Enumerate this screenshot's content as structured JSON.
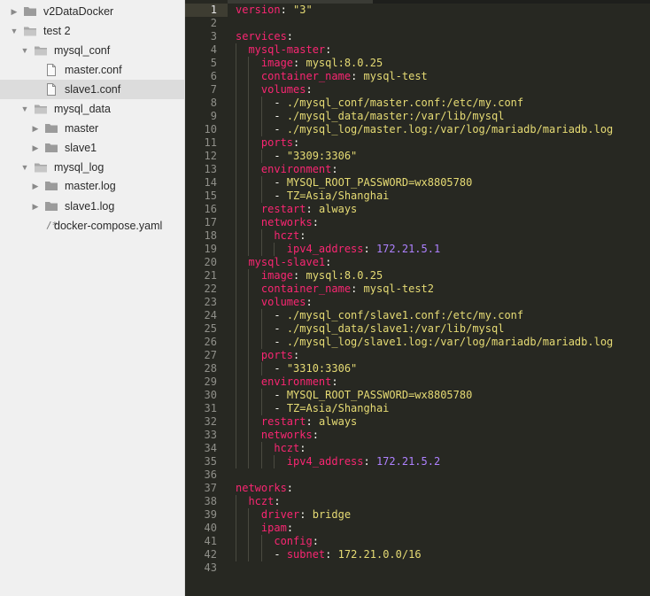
{
  "sidebar": {
    "items": [
      {
        "label": "v2DataDocker",
        "type": "folder",
        "depth": 0,
        "expanded": false
      },
      {
        "label": "test 2",
        "type": "folder-open",
        "depth": 0,
        "expanded": true
      },
      {
        "label": "mysql_conf",
        "type": "folder-open",
        "depth": 1,
        "expanded": true
      },
      {
        "label": "master.conf",
        "type": "file",
        "depth": 2
      },
      {
        "label": "slave1.conf",
        "type": "file",
        "depth": 2,
        "selected": true
      },
      {
        "label": "mysql_data",
        "type": "folder-open",
        "depth": 1,
        "expanded": true
      },
      {
        "label": "master",
        "type": "folder",
        "depth": 2,
        "expanded": false
      },
      {
        "label": "slave1",
        "type": "folder",
        "depth": 2,
        "expanded": false
      },
      {
        "label": "mysql_log",
        "type": "folder-open",
        "depth": 1,
        "expanded": true
      },
      {
        "label": "master.log",
        "type": "folder",
        "depth": 2,
        "expanded": false
      },
      {
        "label": "slave1.log",
        "type": "folder",
        "depth": 2,
        "expanded": false
      },
      {
        "label": "docker-compose.yaml",
        "type": "code-file",
        "depth": 1,
        "glyph": "/*"
      }
    ]
  },
  "editor": {
    "active_line": 1,
    "lines": [
      {
        "n": "1",
        "indent": 0,
        "t": [
          [
            "k",
            "version"
          ],
          [
            "p",
            ": "
          ],
          [
            "s",
            "\"3\""
          ]
        ]
      },
      {
        "n": "2",
        "indent": 0,
        "t": []
      },
      {
        "n": "3",
        "indent": 0,
        "t": [
          [
            "k",
            "services"
          ],
          [
            "p",
            ":"
          ]
        ]
      },
      {
        "n": "4",
        "indent": 1,
        "t": [
          [
            "k",
            "mysql-master"
          ],
          [
            "p",
            ":"
          ]
        ]
      },
      {
        "n": "5",
        "indent": 2,
        "t": [
          [
            "k",
            "image"
          ],
          [
            "p",
            ": "
          ],
          [
            "s",
            "mysql:8.0.25"
          ]
        ]
      },
      {
        "n": "6",
        "indent": 2,
        "t": [
          [
            "k",
            "container_name"
          ],
          [
            "p",
            ": "
          ],
          [
            "s",
            "mysql-test"
          ]
        ]
      },
      {
        "n": "7",
        "indent": 2,
        "t": [
          [
            "k",
            "volumes"
          ],
          [
            "p",
            ":"
          ]
        ]
      },
      {
        "n": "8",
        "indent": 3,
        "t": [
          [
            "p",
            "- "
          ],
          [
            "s",
            "./mysql_conf/master.conf:/etc/my.conf"
          ]
        ]
      },
      {
        "n": "9",
        "indent": 3,
        "t": [
          [
            "p",
            "- "
          ],
          [
            "s",
            "./mysql_data/master:/var/lib/mysql"
          ]
        ]
      },
      {
        "n": "10",
        "indent": 3,
        "t": [
          [
            "p",
            "- "
          ],
          [
            "s",
            "./mysql_log/master.log:/var/log/mariadb/mariadb.log"
          ]
        ]
      },
      {
        "n": "11",
        "indent": 2,
        "t": [
          [
            "k",
            "ports"
          ],
          [
            "p",
            ":"
          ]
        ]
      },
      {
        "n": "12",
        "indent": 3,
        "t": [
          [
            "p",
            "- "
          ],
          [
            "s",
            "\"3309:3306\""
          ]
        ]
      },
      {
        "n": "13",
        "indent": 2,
        "t": [
          [
            "k",
            "environment"
          ],
          [
            "p",
            ":"
          ]
        ]
      },
      {
        "n": "14",
        "indent": 3,
        "t": [
          [
            "p",
            "- "
          ],
          [
            "s",
            "MYSQL_ROOT_PASSWORD=wx8805780"
          ]
        ]
      },
      {
        "n": "15",
        "indent": 3,
        "t": [
          [
            "p",
            "- "
          ],
          [
            "s",
            "TZ=Asia/Shanghai"
          ]
        ]
      },
      {
        "n": "16",
        "indent": 2,
        "t": [
          [
            "k",
            "restart"
          ],
          [
            "p",
            ": "
          ],
          [
            "s",
            "always"
          ]
        ]
      },
      {
        "n": "17",
        "indent": 2,
        "t": [
          [
            "k",
            "networks"
          ],
          [
            "p",
            ":"
          ]
        ]
      },
      {
        "n": "18",
        "indent": 3,
        "t": [
          [
            "k",
            "hczt"
          ],
          [
            "p",
            ":"
          ]
        ]
      },
      {
        "n": "19",
        "indent": 4,
        "t": [
          [
            "k",
            "ipv4_address"
          ],
          [
            "p",
            ": "
          ],
          [
            "n",
            "172.21.5.1"
          ]
        ]
      },
      {
        "n": "20",
        "indent": 1,
        "t": [
          [
            "k",
            "mysql-slave1"
          ],
          [
            "p",
            ":"
          ]
        ]
      },
      {
        "n": "21",
        "indent": 2,
        "t": [
          [
            "k",
            "image"
          ],
          [
            "p",
            ": "
          ],
          [
            "s",
            "mysql:8.0.25"
          ]
        ]
      },
      {
        "n": "22",
        "indent": 2,
        "t": [
          [
            "k",
            "container_name"
          ],
          [
            "p",
            ": "
          ],
          [
            "s",
            "mysql-test2"
          ]
        ]
      },
      {
        "n": "23",
        "indent": 2,
        "t": [
          [
            "k",
            "volumes"
          ],
          [
            "p",
            ":"
          ]
        ]
      },
      {
        "n": "24",
        "indent": 3,
        "t": [
          [
            "p",
            "- "
          ],
          [
            "s",
            "./mysql_conf/slave1.conf:/etc/my.conf"
          ]
        ]
      },
      {
        "n": "25",
        "indent": 3,
        "t": [
          [
            "p",
            "- "
          ],
          [
            "s",
            "./mysql_data/slave1:/var/lib/mysql"
          ]
        ]
      },
      {
        "n": "26",
        "indent": 3,
        "t": [
          [
            "p",
            "- "
          ],
          [
            "s",
            "./mysql_log/slave1.log:/var/log/mariadb/mariadb.log"
          ]
        ]
      },
      {
        "n": "27",
        "indent": 2,
        "t": [
          [
            "k",
            "ports"
          ],
          [
            "p",
            ":"
          ]
        ]
      },
      {
        "n": "28",
        "indent": 3,
        "t": [
          [
            "p",
            "- "
          ],
          [
            "s",
            "\"3310:3306\""
          ]
        ]
      },
      {
        "n": "29",
        "indent": 2,
        "t": [
          [
            "k",
            "environment"
          ],
          [
            "p",
            ":"
          ]
        ]
      },
      {
        "n": "30",
        "indent": 3,
        "t": [
          [
            "p",
            "- "
          ],
          [
            "s",
            "MYSQL_ROOT_PASSWORD=wx8805780"
          ]
        ]
      },
      {
        "n": "31",
        "indent": 3,
        "t": [
          [
            "p",
            "- "
          ],
          [
            "s",
            "TZ=Asia/Shanghai"
          ]
        ]
      },
      {
        "n": "32",
        "indent": 2,
        "t": [
          [
            "k",
            "restart"
          ],
          [
            "p",
            ": "
          ],
          [
            "s",
            "always"
          ]
        ]
      },
      {
        "n": "33",
        "indent": 2,
        "t": [
          [
            "k",
            "networks"
          ],
          [
            "p",
            ":"
          ]
        ]
      },
      {
        "n": "34",
        "indent": 3,
        "t": [
          [
            "k",
            "hczt"
          ],
          [
            "p",
            ":"
          ]
        ]
      },
      {
        "n": "35",
        "indent": 4,
        "t": [
          [
            "k",
            "ipv4_address"
          ],
          [
            "p",
            ": "
          ],
          [
            "n",
            "172.21.5.2"
          ]
        ]
      },
      {
        "n": "36",
        "indent": 0,
        "t": []
      },
      {
        "n": "37",
        "indent": 0,
        "t": [
          [
            "k",
            "networks"
          ],
          [
            "p",
            ":"
          ]
        ]
      },
      {
        "n": "38",
        "indent": 1,
        "t": [
          [
            "k",
            "hczt"
          ],
          [
            "p",
            ":"
          ]
        ]
      },
      {
        "n": "39",
        "indent": 2,
        "t": [
          [
            "k",
            "driver"
          ],
          [
            "p",
            ": "
          ],
          [
            "s",
            "bridge"
          ]
        ]
      },
      {
        "n": "40",
        "indent": 2,
        "t": [
          [
            "k",
            "ipam"
          ],
          [
            "p",
            ":"
          ]
        ]
      },
      {
        "n": "41",
        "indent": 3,
        "t": [
          [
            "k",
            "config"
          ],
          [
            "p",
            ":"
          ]
        ]
      },
      {
        "n": "42",
        "indent": 3,
        "t": [
          [
            "p",
            "- "
          ],
          [
            "k",
            "subnet"
          ],
          [
            "p",
            ": "
          ],
          [
            "s",
            "172.21.0.0/16"
          ]
        ]
      },
      {
        "n": "43",
        "indent": 0,
        "t": []
      }
    ]
  },
  "colors": {
    "sidebar_bg": "#f0f0f0",
    "selected_row": "#dcdcdc",
    "editor_bg": "#272822",
    "keyword": "#f92672",
    "string": "#e6db74",
    "number": "#ae81ff",
    "folder_icon": "#9b9b9b"
  },
  "icons": {
    "collapsed": "chevron-right-icon",
    "expanded": "chevron-down-icon",
    "folder": "folder-icon",
    "file": "file-icon"
  }
}
